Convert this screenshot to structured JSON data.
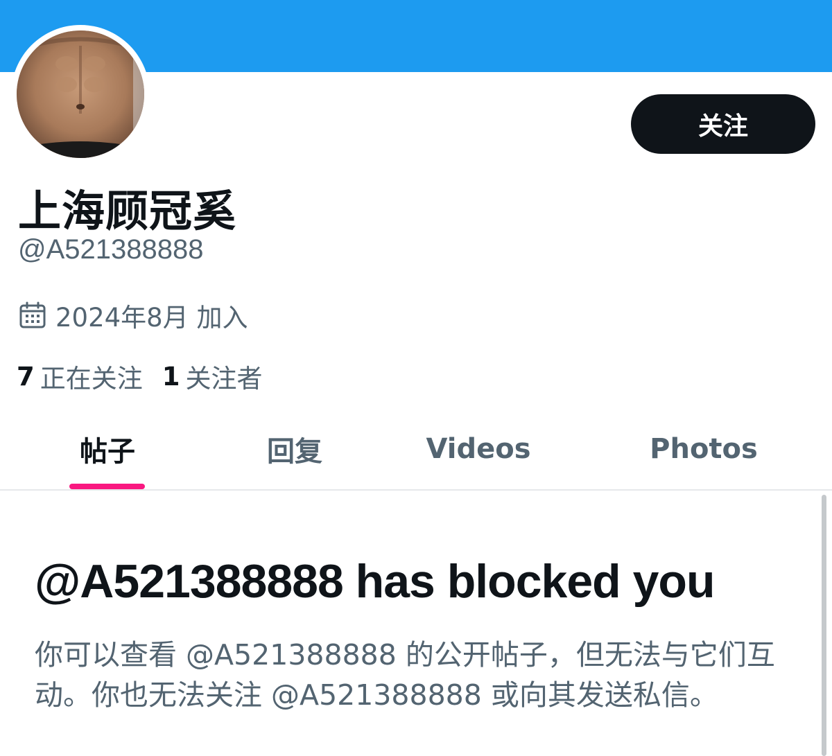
{
  "profile": {
    "display_name": "上海顾冠奚",
    "handle": "@A521388888",
    "joined": "2024年8月 加入",
    "follow_label": "关注",
    "stats": [
      {
        "count": "7",
        "label": "正在关注"
      },
      {
        "count": "1",
        "label": "关注者"
      }
    ]
  },
  "tabs": [
    {
      "label": "帖子",
      "active": true
    },
    {
      "label": "回复",
      "active": false
    },
    {
      "label": "Videos",
      "active": false
    },
    {
      "label": "Photos",
      "active": false
    }
  ],
  "blocked": {
    "title": "@A521388888 has blocked you",
    "description": "你可以查看 @A521388888 的公开帖子，但无法与它们互动。你也无法关注 @A521388888 或向其发送私信。"
  },
  "colors": {
    "banner": "#1d9bf0",
    "follow_button_bg": "#0f1419",
    "primary_text": "#0f1419",
    "secondary_text": "#536471",
    "tab_indicator": "#f91880"
  },
  "icons": {
    "joined": "calendar-icon"
  }
}
